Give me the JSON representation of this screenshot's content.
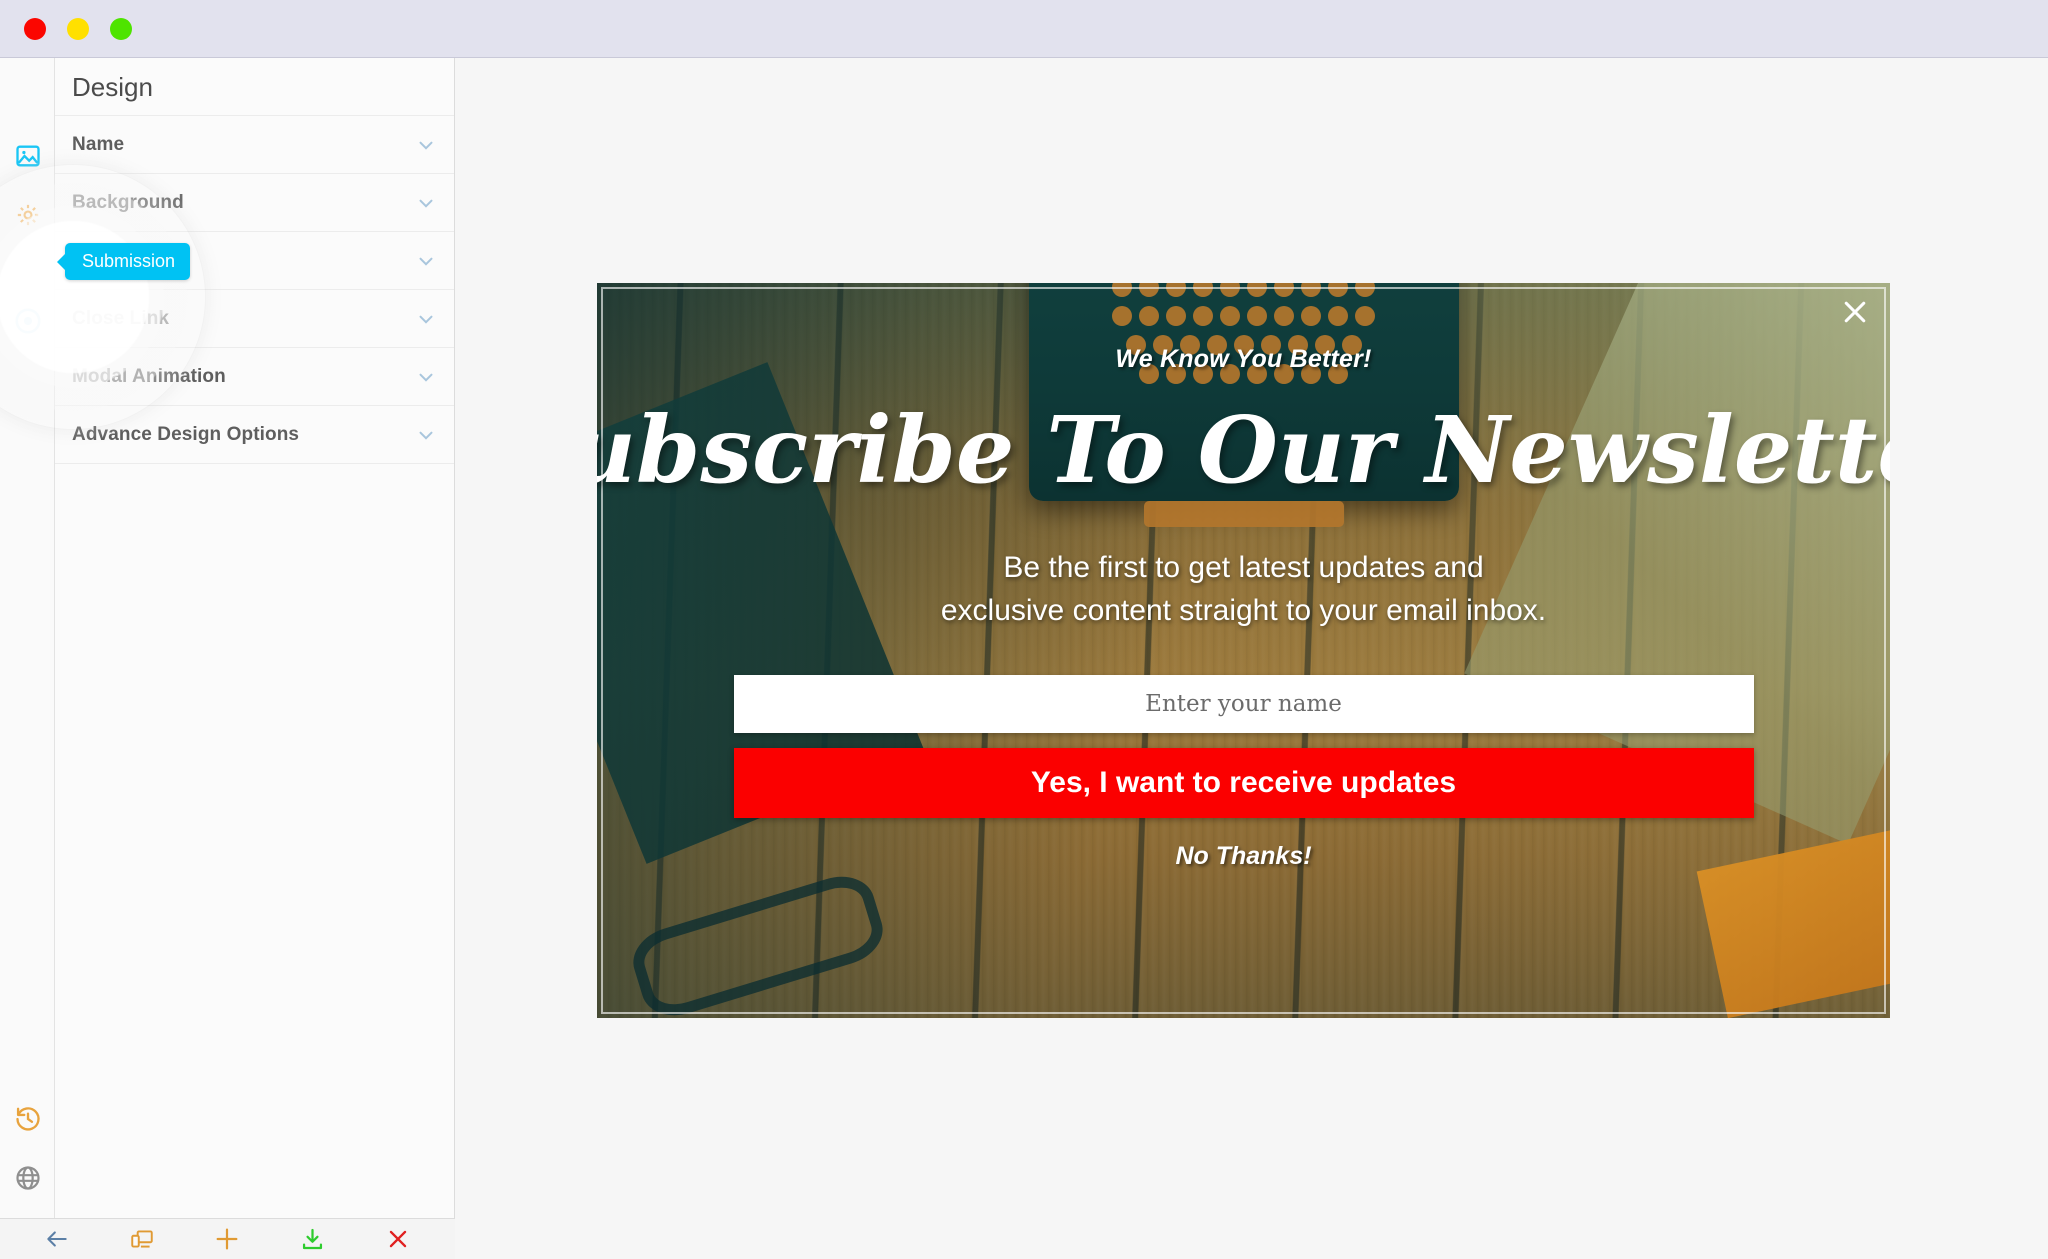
{
  "window": {
    "traffic_lights": [
      {
        "name": "close",
        "color": "#fb0600"
      },
      {
        "name": "minimize",
        "color": "#ffe000"
      },
      {
        "name": "zoom",
        "color": "#4ee400"
      }
    ]
  },
  "rail": {
    "top_icons": [
      {
        "name": "image-icon",
        "color": "#1ac6f5"
      },
      {
        "name": "gear-icon",
        "color": "#f0a030"
      },
      {
        "name": "target-icon",
        "color": "#1a9ee0"
      }
    ],
    "bottom_icons": [
      {
        "name": "history-restore-icon",
        "color": "#e8a33d"
      },
      {
        "name": "globe-icon",
        "color": "#9a9a9a"
      }
    ]
  },
  "panel": {
    "title": "Design",
    "sections": [
      {
        "label": "Name"
      },
      {
        "label": "Background"
      },
      {
        "label": "Submission"
      },
      {
        "label": "Close Link"
      },
      {
        "label": "Modal Animation"
      },
      {
        "label": "Advance Design Options"
      }
    ]
  },
  "tooltip": {
    "label": "Submission",
    "color": "#00c2f3"
  },
  "toolbar": {
    "buttons": [
      {
        "name": "back-button",
        "icon": "arrow-left-icon",
        "color": "#5b7fa6"
      },
      {
        "name": "device-preview-button",
        "icon": "devices-icon",
        "color": "#e09a33"
      },
      {
        "name": "add-button",
        "icon": "plus-icon",
        "color": "#e09a33"
      },
      {
        "name": "save-download-button",
        "icon": "download-icon",
        "color": "#2ecc2e"
      },
      {
        "name": "close-button",
        "icon": "close-x-icon",
        "color": "#e02020"
      }
    ]
  },
  "modal": {
    "kicker": "We Know You Better!",
    "headline": "Subscribe To Our Newsletter",
    "subcopy_line1": "Be the first to get latest updates and",
    "subcopy_line2": "exclusive content straight to your email inbox.",
    "name_input_placeholder": "Enter your name",
    "name_input_value": "",
    "cta_label": "Yes, I want to receive updates",
    "decline_label": "No Thanks!",
    "close_icon": "close-x-icon",
    "cta_color": "#fb0000",
    "text_color": "#ffffff"
  }
}
